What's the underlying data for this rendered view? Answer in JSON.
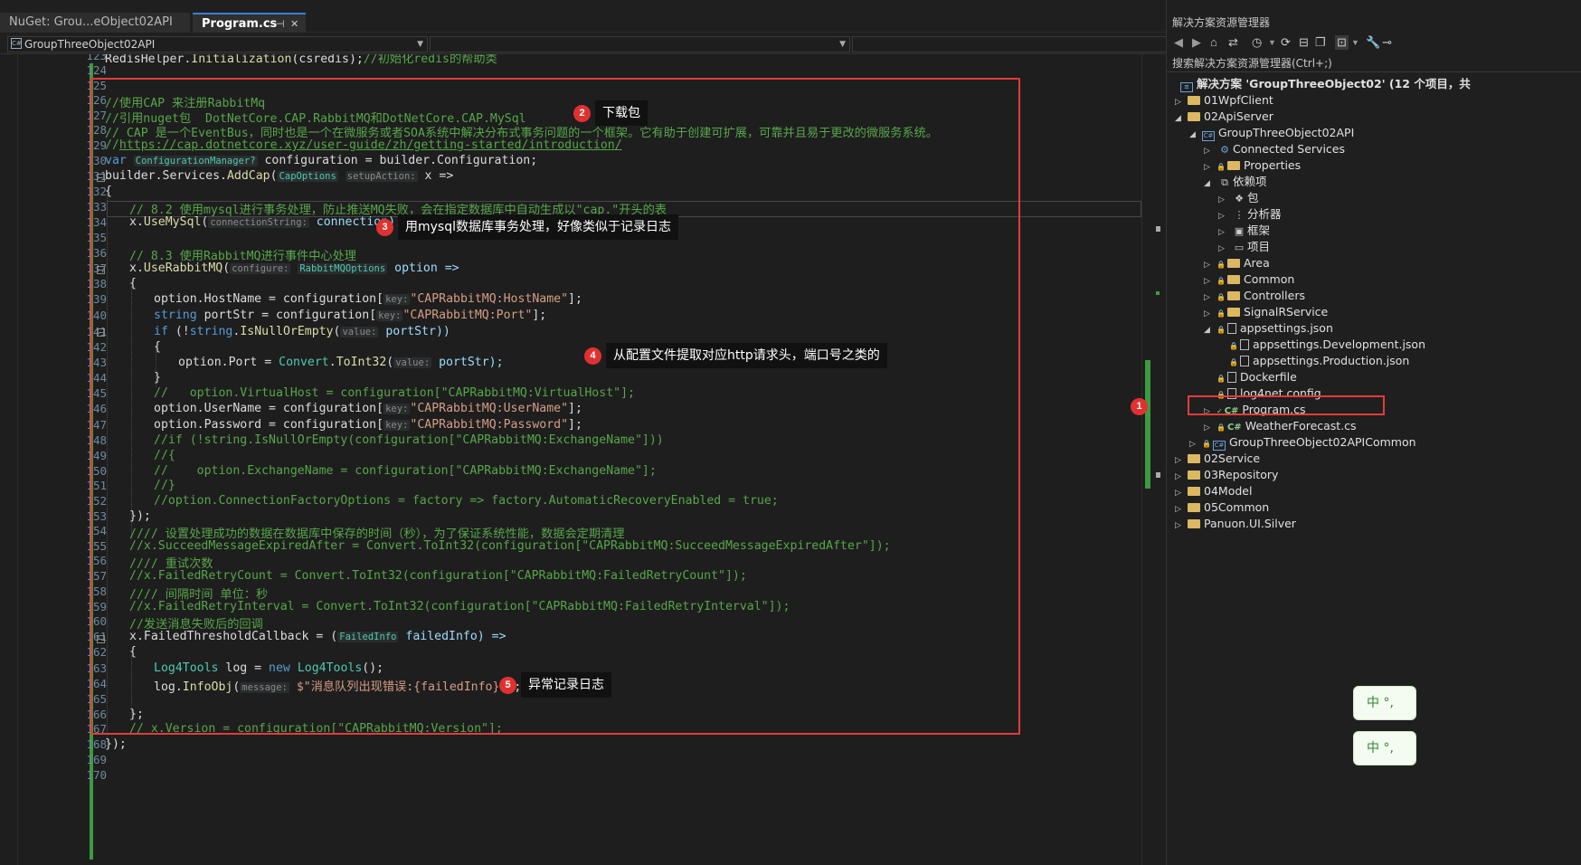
{
  "tabs": {
    "nuget": "NuGet: Grou...eObject02API",
    "program": "Program.cs"
  },
  "navbar": {
    "project": "GroupThreeObject02API",
    "type": "",
    "member": ""
  },
  "code": {
    "line_numbers": [
      "123",
      "124",
      "125",
      "126",
      "127",
      "128",
      "129",
      "130",
      "131",
      "132",
      "133",
      "134",
      "135",
      "136",
      "137",
      "138",
      "139",
      "140",
      "141",
      "142",
      "143",
      "144",
      "145",
      "146",
      "147",
      "148",
      "149",
      "150",
      "151",
      "152",
      "153",
      "154",
      "155",
      "156",
      "157",
      "158",
      "159",
      "160",
      "161",
      "162",
      "163",
      "164",
      "165",
      "166",
      "167",
      "168",
      "169",
      "170"
    ],
    "l123_a": "RedisHelper.",
    "l123_b": "Initialization",
    "l123_c": "(csredis);",
    "l123_d": "//初始化redis的帮助类",
    "l126": "//使用CAP 来注册RabbitMq",
    "l127": "//引用nuget包  DotNetCore.CAP.RabbitMQ和DotNetCore.CAP.MySql",
    "l128": "// CAP 是一个EventBus，同时也是一个在微服务或者SOA系统中解决分布式事务问题的一个框架。它有助于创建可扩展，可靠并且易于更改的微服务系统。",
    "l129_a": "//",
    "l129_b": "https://cap.dotnetcore.xyz/user-guide/zh/getting-started/introduction/",
    "l130_kw": "var",
    "l130_hint": "ConfigurationManager?",
    "l130_rest": " configuration = builder.Configuration;",
    "l131_a": "builder.Services.",
    "l131_b": "AddCap",
    "l131_h1": "CapOptions",
    "l131_h2": "setupAction:",
    "l131_c": " x =>",
    "l132": "{",
    "l133": "// 8.2 使用mysql进行事务处理，防止推送MQ失败，会在指定数据库中自动生成以\"cap.\"开头的表",
    "l134_a": "x.",
    "l134_b": "UseMySql",
    "l134_h": "connectionString:",
    "l134_c": " connection);",
    "l136": "// 8.3 使用RabbitMQ进行事件中心处理",
    "l137_a": "x.",
    "l137_b": "UseRabbitMQ",
    "l137_h1": "configure:",
    "l137_h2": "RabbitMQOptions",
    "l137_c": " option =>",
    "l138": "{",
    "l139_a": "option.HostName = configuration[",
    "l139_h": "key:",
    "l139_s": "\"CAPRabbitMQ:HostName\"",
    "l139_e": "];",
    "l140_kw": "string",
    "l140_a": " portStr = configuration[",
    "l140_h": "key:",
    "l140_s": "\"CAPRabbitMQ:Port\"",
    "l140_e": "];",
    "l141_kw": "if",
    "l141_a": " (!",
    "l141_kw2": "string",
    "l141_b": ".",
    "l141_m": "IsNullOrEmpty",
    "l141_h": "value:",
    "l141_c": " portStr))",
    "l142": "{",
    "l143_a": "option.Port = ",
    "l143_t": "Convert",
    "l143_b": ".",
    "l143_m": "ToInt32",
    "l143_h": "value:",
    "l143_c": " portStr);",
    "l144": "}",
    "l145": "//   option.VirtualHost = configuration[\"CAPRabbitMQ:VirtualHost\"];",
    "l146_a": "option.UserName = configuration[",
    "l146_h": "key:",
    "l146_s": "\"CAPRabbitMQ:UserName\"",
    "l146_e": "];",
    "l147_a": "option.Password = configuration[",
    "l147_h": "key:",
    "l147_s": "\"CAPRabbitMQ:Password\"",
    "l147_e": "];",
    "l148": "//if (!string.IsNullOrEmpty(configuration[\"CAPRabbitMQ:ExchangeName\"]))",
    "l149": "//{",
    "l150": "//    option.ExchangeName = configuration[\"CAPRabbitMQ:ExchangeName\"];",
    "l151": "//}",
    "l152": "//option.ConnectionFactoryOptions = factory => factory.AutomaticRecoveryEnabled = true;",
    "l153": "});",
    "l154": "//// 设置处理成功的数据在数据库中保存的时间（秒），为了保证系统性能，数据会定期清理",
    "l155": "//x.SucceedMessageExpiredAfter = Convert.ToInt32(configuration[\"CAPRabbitMQ:SucceedMessageExpiredAfter\"]);",
    "l156": "//// 重试次数",
    "l157": "//x.FailedRetryCount = Convert.ToInt32(configuration[\"CAPRabbitMQ:FailedRetryCount\"]);",
    "l158": "//// 间隔时间 单位：秒",
    "l159": "//x.FailedRetryInterval = Convert.ToInt32(configuration[\"CAPRabbitMQ:FailedRetryInterval\"]);",
    "l160": "//发送消息失败后的回调",
    "l161_a": "x.FailedThresholdCallback = (",
    "l161_h": "FailedInfo",
    "l161_c": " failedInfo) =>",
    "l162": "{",
    "l163_t": "Log4Tools",
    "l163_a": " log = ",
    "l163_kw": "new",
    "l163_t2": " Log4Tools",
    "l163_b": "();",
    "l164_a": "log.",
    "l164_m": "InfoObj",
    "l164_h": "message:",
    "l164_s": "$\"消息队列出现错误:{failedInfo}\"",
    "l164_e": ");",
    "l166": "};",
    "l167": "// x.Version = configuration[\"CAPRabbitMQ:Version\"];",
    "l168": "});"
  },
  "callouts": {
    "c1_num": "1",
    "c2_num": "2",
    "c2_text": "下载包",
    "c3_num": "3",
    "c3_text": "用mysql数据库事务处理，好像类似于记录日志",
    "c4_num": "4",
    "c4_text": "从配置文件提取对应http请求头，端口号之类的",
    "c5_num": "5",
    "c5_text": "异常记录日志"
  },
  "explorer": {
    "title": "解决方案资源管理器",
    "search_placeholder": "搜索解决方案资源管理器(Ctrl+;)",
    "solution": "解决方案 'GroupThreeObject02' (12 个项目，共",
    "items": [
      {
        "label": "01WpfClient"
      },
      {
        "label": "02ApiServer"
      },
      {
        "label": "GroupThreeObject02API"
      },
      {
        "label": "Connected Services"
      },
      {
        "label": "Properties"
      },
      {
        "label": "依赖项"
      },
      {
        "label": "包"
      },
      {
        "label": "分析器"
      },
      {
        "label": "框架"
      },
      {
        "label": "项目"
      },
      {
        "label": "Area"
      },
      {
        "label": "Common"
      },
      {
        "label": "Controllers"
      },
      {
        "label": "SignalRService"
      },
      {
        "label": "appsettings.json"
      },
      {
        "label": "appsettings.Development.json"
      },
      {
        "label": "appsettings.Production.json"
      },
      {
        "label": "Dockerfile"
      },
      {
        "label": "log4net.config"
      },
      {
        "label": "Program.cs"
      },
      {
        "label": "WeatherForecast.cs"
      },
      {
        "label": "GroupThreeObject02APICommon"
      },
      {
        "label": "02Service"
      },
      {
        "label": "03Repository"
      },
      {
        "label": "04Model"
      },
      {
        "label": "05Common"
      },
      {
        "label": "Panuon.UI.Silver"
      }
    ]
  },
  "ime": {
    "label1": "中 °,",
    "label2": "中 °,"
  },
  "colors": {
    "highlight_red": "#e33b3b",
    "change_green": "#3d9a40",
    "comment": "#57a64a",
    "keyword": "#569cd6",
    "type": "#4ec9b0",
    "string": "#d69d85"
  }
}
